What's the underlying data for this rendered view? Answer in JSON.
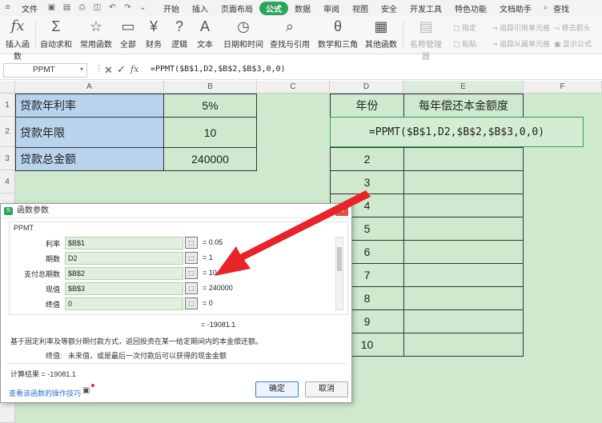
{
  "menubar": {
    "file": "文件",
    "items": [
      "开始",
      "插入",
      "页面布局",
      "公式",
      "数据",
      "审阅",
      "视图",
      "安全",
      "开发工具",
      "特色功能",
      "文档助手"
    ],
    "active": "公式",
    "search": "查找"
  },
  "ribbon": {
    "insert_function": "插入函数",
    "autosum": "自动求和",
    "common": "常用函数",
    "all": "全部",
    "finance": "财务",
    "logic": "逻辑",
    "text": "文本",
    "datetime": "日期和时间",
    "lookup": "查找与引用",
    "math": "数学和三角",
    "other": "其他函数",
    "name_manager": "名称管理器",
    "define": "指定",
    "paste": "粘贴",
    "trace_precedents": "追踪引用单元格",
    "trace_dependents": "追踪从属单元格",
    "remove_arrows": "移去箭头",
    "show_formulas": "显示公式"
  },
  "formula_bar": {
    "name_box": "PPMT",
    "formula": "=PPMT($B$1,D2,$B$2,$B$3,0,0)"
  },
  "sheet": {
    "columns": [
      "A",
      "B",
      "C",
      "D",
      "E",
      "F"
    ],
    "rows": [
      "1",
      "2",
      "3",
      "4"
    ],
    "a1": "贷款年利率",
    "b1": "5%",
    "a2": "贷款年限",
    "b2": "10",
    "a3": "贷款总金额",
    "b3": "240000",
    "d1": "年份",
    "e1": "每年偿还本金额度",
    "d2_formula": "=PPMT($B$1,D2,$B$2,$B$3,0,0)",
    "years": [
      "2",
      "3",
      "4",
      "5",
      "6",
      "7",
      "8",
      "9",
      "10"
    ]
  },
  "dialog": {
    "title": "函数参数",
    "function": "PPMT",
    "args": [
      {
        "label": "利率",
        "value": "$B$1",
        "result": "= 0.05"
      },
      {
        "label": "期数",
        "value": "D2",
        "result": "= 1"
      },
      {
        "label": "支付总期数",
        "value": "$B$2",
        "result": "= 10"
      },
      {
        "label": "现值",
        "value": "$B$3",
        "result": "= 240000"
      },
      {
        "label": "终值",
        "value": "0",
        "result": "= 0"
      }
    ],
    "total": "= -19081.1",
    "description": "基于固定利率及等额分期付款方式，返回投资在某一给定期间内的本金偿还额。",
    "arg_desc_label": "终值:",
    "arg_desc": "未来值，或是最后一次付款后可以获得的现金金额",
    "result_line": "计算结果 = -19081.1",
    "help_link": "查看该函数的操作技巧",
    "ok": "确定",
    "cancel": "取消"
  },
  "colors": {
    "accent": "#2aa55b",
    "arrow": "#e8232a",
    "sheet_green": "#cfe9cf",
    "blue_cell": "#b8d4ec"
  }
}
